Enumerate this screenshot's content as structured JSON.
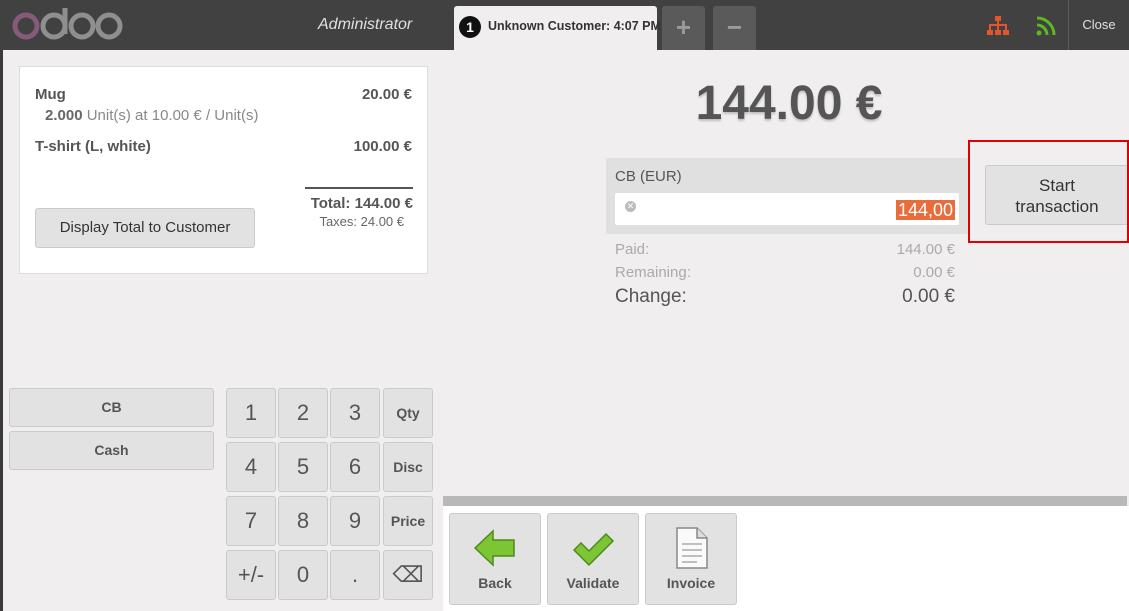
{
  "header": {
    "brand": "odoo",
    "user": "Administrator",
    "order_number": "1",
    "order_label": "Unknown Customer: 4:07 PM",
    "add_label": "+",
    "remove_label": "−",
    "close_label": "Close"
  },
  "order": {
    "lines": [
      {
        "name": "Mug",
        "price": "20.00 €",
        "qty": "2.000",
        "info": "Unit(s) at 10.00 € / Unit(s)"
      },
      {
        "name": "T-shirt (L, white)",
        "price": "100.00 €"
      }
    ],
    "total": "Total: 144.00 €",
    "taxes": "Taxes: 24.00 €",
    "display_total_label": "Display Total to Customer"
  },
  "payment_methods": [
    "CB",
    "Cash"
  ],
  "numpad": {
    "keys": [
      "1",
      "2",
      "3",
      "Qty",
      "4",
      "5",
      "6",
      "Disc",
      "7",
      "8",
      "9",
      "Price",
      "+/-",
      "0",
      ".",
      "⌫"
    ]
  },
  "payment": {
    "due": "144.00 €",
    "line_label": "CB (EUR)",
    "line_amount": "144,00",
    "paid_label": "Paid:",
    "paid_value": "144.00 €",
    "remaining_label": "Remaining:",
    "remaining_value": "0.00 €",
    "change_label": "Change:",
    "change_value": "0.00 €",
    "start_transaction_line1": "Start",
    "start_transaction_line2": "transaction"
  },
  "actions": {
    "back_label": "Back",
    "validate_label": "Validate",
    "invoice_label": "Invoice"
  },
  "colors": {
    "brand_purple": "#875a7b",
    "selection_orange": "#e96d3c",
    "highlight_red": "#e00000",
    "topbar": "#414141"
  }
}
